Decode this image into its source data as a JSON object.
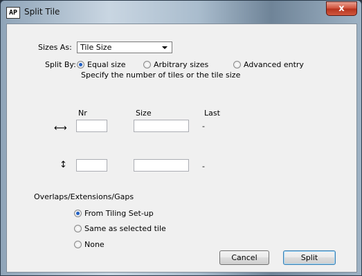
{
  "window": {
    "app_icon": "AP",
    "title": "Split Tile",
    "close_label": "x"
  },
  "sizes_as": {
    "label": "Sizes As:",
    "selected": "Tile Size"
  },
  "split_by": {
    "label": "Split By:",
    "options": [
      "Equal size",
      "Arbitrary sizes",
      "Advanced entry"
    ],
    "selected": "Equal size",
    "hint": "Specify the number of tiles or the tile size"
  },
  "grid": {
    "headers": {
      "nr": "Nr",
      "size": "Size",
      "last": "Last"
    },
    "rows": [
      {
        "icon": "horizontal-arrow-icon",
        "glyph": "⟷",
        "nr": "",
        "size": "",
        "last": "-"
      },
      {
        "icon": "vertical-arrow-icon",
        "glyph": "↕",
        "nr": "",
        "size": "",
        "last": "-"
      }
    ]
  },
  "overlaps": {
    "label": "Overlaps/Extensions/Gaps",
    "options": [
      "From Tiling Set-up",
      "Same as selected tile",
      "None"
    ],
    "selected": "From Tiling Set-up"
  },
  "buttons": {
    "cancel": "Cancel",
    "split": "Split"
  },
  "colors": {
    "accent": "#2160c4",
    "close": "#c9402a"
  }
}
